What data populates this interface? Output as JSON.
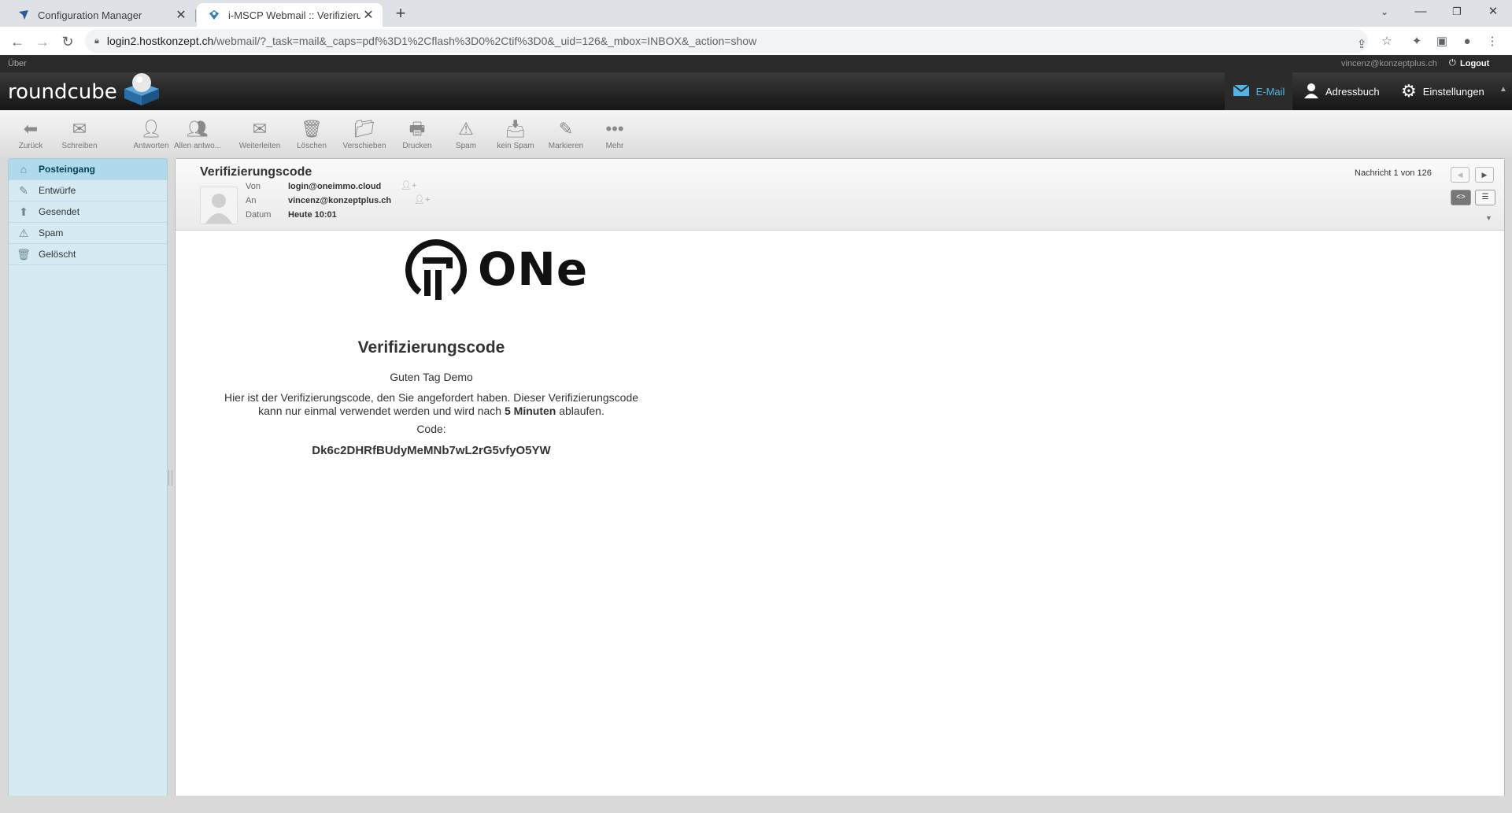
{
  "browser": {
    "tabs": [
      {
        "title": "Configuration Manager"
      },
      {
        "title": "i-MSCP Webmail :: Verifizierungs"
      }
    ],
    "url_host": "login2.hostkonzept.ch",
    "url_path": "/webmail/?_task=mail&_caps=pdf%3D1%2Cflash%3D0%2Ctif%3D0&_uid=126&_mbox=INBOX&_action=show"
  },
  "topline": {
    "about": "Über",
    "user_email": "vincenz@konzeptplus.ch",
    "logout": "Logout"
  },
  "header": {
    "logo_text": "roundcube",
    "nav": {
      "mail": "E-Mail",
      "addressbook": "Adressbuch",
      "settings": "Einstellungen"
    }
  },
  "toolbar": {
    "back": "Zurück",
    "compose": "Schreiben",
    "reply": "Antworten",
    "reply_all": "Allen antwo...",
    "forward": "Weiterleiten",
    "delete": "Löschen",
    "move": "Verschieben",
    "print": "Drucken",
    "spam": "Spam",
    "not_spam": "kein Spam",
    "mark": "Markieren",
    "more": "Mehr"
  },
  "folders": [
    {
      "label": "Posteingang",
      "icon": "inbox-icon",
      "selected": true
    },
    {
      "label": "Entwürfe",
      "icon": "pencil-icon",
      "selected": false
    },
    {
      "label": "Gesendet",
      "icon": "sent-icon",
      "selected": false
    },
    {
      "label": "Spam",
      "icon": "spam-icon",
      "selected": false
    },
    {
      "label": "Gelöscht",
      "icon": "trash-icon",
      "selected": false
    }
  ],
  "message": {
    "subject": "Verifizierungscode",
    "from_label": "Von",
    "from": "login@oneimmo.cloud",
    "to_label": "An",
    "to": "vincenz@konzeptplus.ch",
    "date_label": "Datum",
    "date": "Heute 10:01",
    "counter": "Nachricht 1 von 126"
  },
  "email": {
    "brand": "ONe",
    "title": "Verifizierungscode",
    "greeting": "Guten Tag Demo",
    "para_line1": "Hier ist der Verifizierungscode, den Sie angefordert haben. Dieser Verifizierungscode",
    "para_line2_pre": "kann nur einmal verwendet werden und wird nach ",
    "para_line2_bold": "5 Minuten",
    "para_line2_post": " ablaufen.",
    "code_label": "Code:",
    "code": "Dk6c2DHRfBUdyMeMNb7wL2rG5vfyO5YW"
  },
  "colors": {
    "accent": "#52b5e5",
    "folder_bg": "#d6eaf3",
    "folder_selected": "#b0d9ec",
    "header_dark": "#1a1a1a"
  }
}
